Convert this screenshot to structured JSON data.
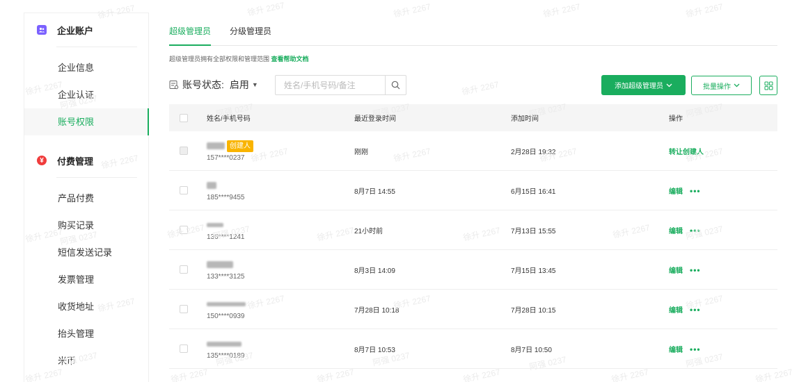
{
  "sidebar": {
    "group1": {
      "label": "企业账户",
      "icon": "enterprise-account-icon",
      "icon_color": "#7b61ff"
    },
    "items1": [
      {
        "label": "企业信息",
        "active": false
      },
      {
        "label": "企业认证",
        "active": false
      },
      {
        "label": "账号权限",
        "active": true
      }
    ],
    "group2": {
      "label": "付费管理",
      "icon": "yuan-icon",
      "icon_color": "#f03c3c"
    },
    "items2": [
      {
        "label": "产品付费"
      },
      {
        "label": "购买记录"
      },
      {
        "label": "短信发送记录"
      },
      {
        "label": "发票管理"
      },
      {
        "label": "收货地址"
      },
      {
        "label": "抬头管理"
      },
      {
        "label": "米币"
      }
    ]
  },
  "tabs": [
    {
      "label": "超级管理员",
      "active": true
    },
    {
      "label": "分级管理员",
      "active": false
    }
  ],
  "description": {
    "text": "超级管理员拥有全部权限和管理范围",
    "link": "查看帮助文档"
  },
  "toolbar": {
    "status_label": "账号状态:",
    "status_value": "启用",
    "search_placeholder": "姓名/手机号码/备注",
    "add_button": "添加超级管理员",
    "batch_button": "批量操作"
  },
  "table": {
    "columns": [
      "姓名/手机号码",
      "最近登录时间",
      "添加时间",
      "操作"
    ],
    "rows": [
      {
        "phone": "157****0237",
        "badge": "创建人",
        "last_login": "刚刚",
        "added": "2月28日 19:32",
        "action": "转让创建人",
        "more": ""
      },
      {
        "phone": "185****9455",
        "badge": "",
        "last_login": "8月7日 14:55",
        "added": "6月15日 16:41",
        "action": "编辑",
        "more": "•••"
      },
      {
        "phone": "136****1241",
        "badge": "",
        "last_login": "21小时前",
        "added": "7月13日 15:55",
        "action": "编辑",
        "more": "•••"
      },
      {
        "phone": "133****3125",
        "badge": "",
        "last_login": "8月3日 14:09",
        "added": "7月15日 13:45",
        "action": "编辑",
        "more": "•••"
      },
      {
        "phone": "150****0939",
        "badge": "",
        "last_login": "7月28日 10:18",
        "added": "7月28日 10:15",
        "action": "编辑",
        "more": "•••"
      },
      {
        "phone": "135****0189",
        "badge": "",
        "last_login": "8月7日 10:53",
        "added": "8月7日 10:50",
        "action": "编辑",
        "more": "•••"
      }
    ]
  },
  "watermark": {
    "line1": "徐升 2267",
    "line2": "阿强 0237"
  },
  "colors": {
    "accent": "#1aad5e",
    "badge": "#f9b400"
  }
}
